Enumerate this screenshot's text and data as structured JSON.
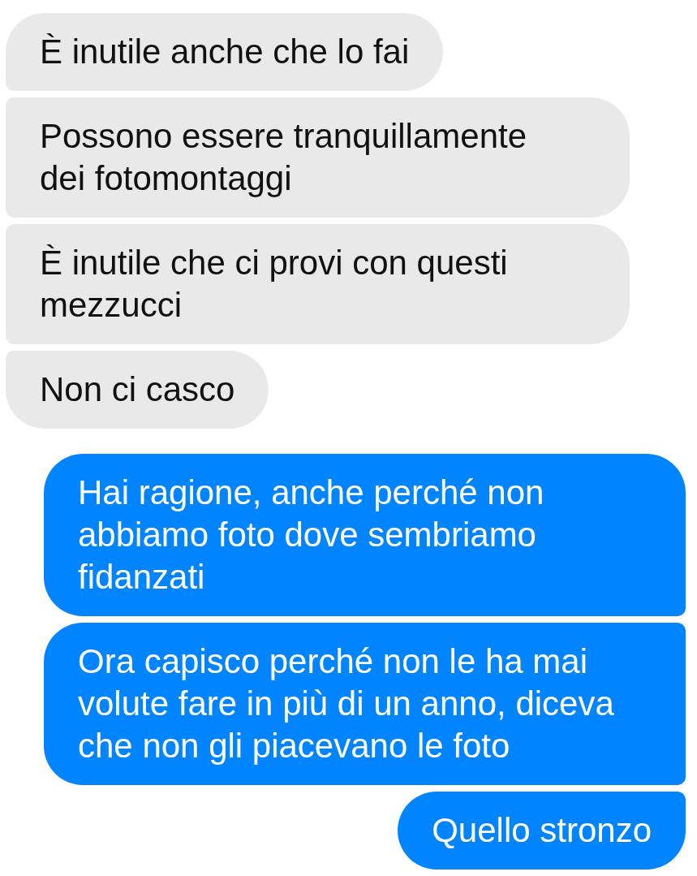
{
  "messages": [
    {
      "kind": "received",
      "text": "È inutile anche che lo fai"
    },
    {
      "kind": "received",
      "text": "Possono essere tranquillamente\ndei fotomontaggi"
    },
    {
      "kind": "received",
      "text": "È inutile che ci provi con questi\nmezzucci"
    },
    {
      "kind": "received",
      "text": "Non ci casco"
    },
    {
      "kind": "sent",
      "text": "Hai ragione, anche perché non\nabbiamo foto dove sembriamo\nfidanzati"
    },
    {
      "kind": "sent",
      "text": "Ora capisco perché non le ha mai\nvolute fare in più di un anno, diceva\nche non gli piacevano le foto"
    },
    {
      "kind": "sent",
      "text": "Quello stronzo"
    }
  ]
}
